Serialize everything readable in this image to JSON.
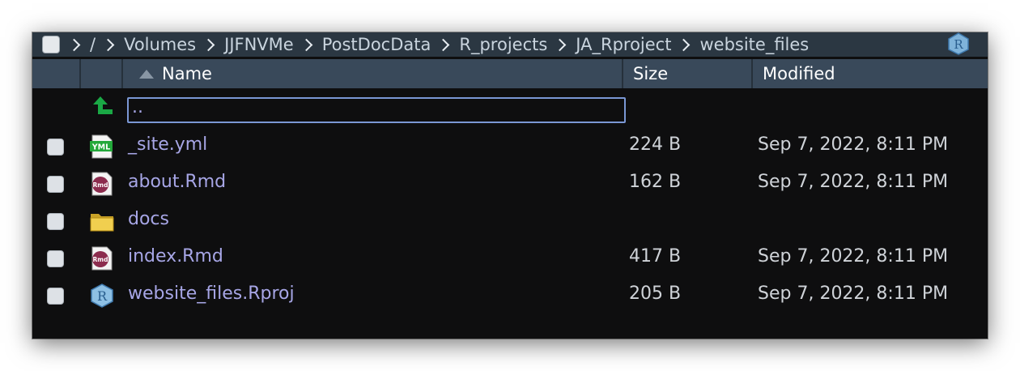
{
  "breadcrumb": {
    "items": [
      "/",
      "Volumes",
      "JJFNVMe",
      "PostDocData",
      "R_projects",
      "JA_Rproject",
      "website_files"
    ]
  },
  "columns": {
    "name": "Name",
    "size": "Size",
    "modified": "Modified"
  },
  "up_row": {
    "name": ".."
  },
  "files": [
    {
      "name": "_site.yml",
      "size": "224 B",
      "modified": "Sep 7, 2022, 8:11 PM",
      "icon": "yml-file-icon"
    },
    {
      "name": "about.Rmd",
      "size": "162 B",
      "modified": "Sep 7, 2022, 8:11 PM",
      "icon": "rmd-file-icon"
    },
    {
      "name": "docs",
      "size": "",
      "modified": "",
      "icon": "folder-icon"
    },
    {
      "name": "index.Rmd",
      "size": "417 B",
      "modified": "Sep 7, 2022, 8:11 PM",
      "icon": "rmd-file-icon"
    },
    {
      "name": "website_files.Rproj",
      "size": "205 B",
      "modified": "Sep 7, 2022, 8:11 PM",
      "icon": "rproj-file-icon"
    }
  ],
  "colors": {
    "header_bg": "#39495a",
    "breadcrumb_bg": "#2b3742",
    "filename_text": "#a7a6e6",
    "up_arrow": "#1aa845",
    "focus_border": "#7a97d4"
  }
}
